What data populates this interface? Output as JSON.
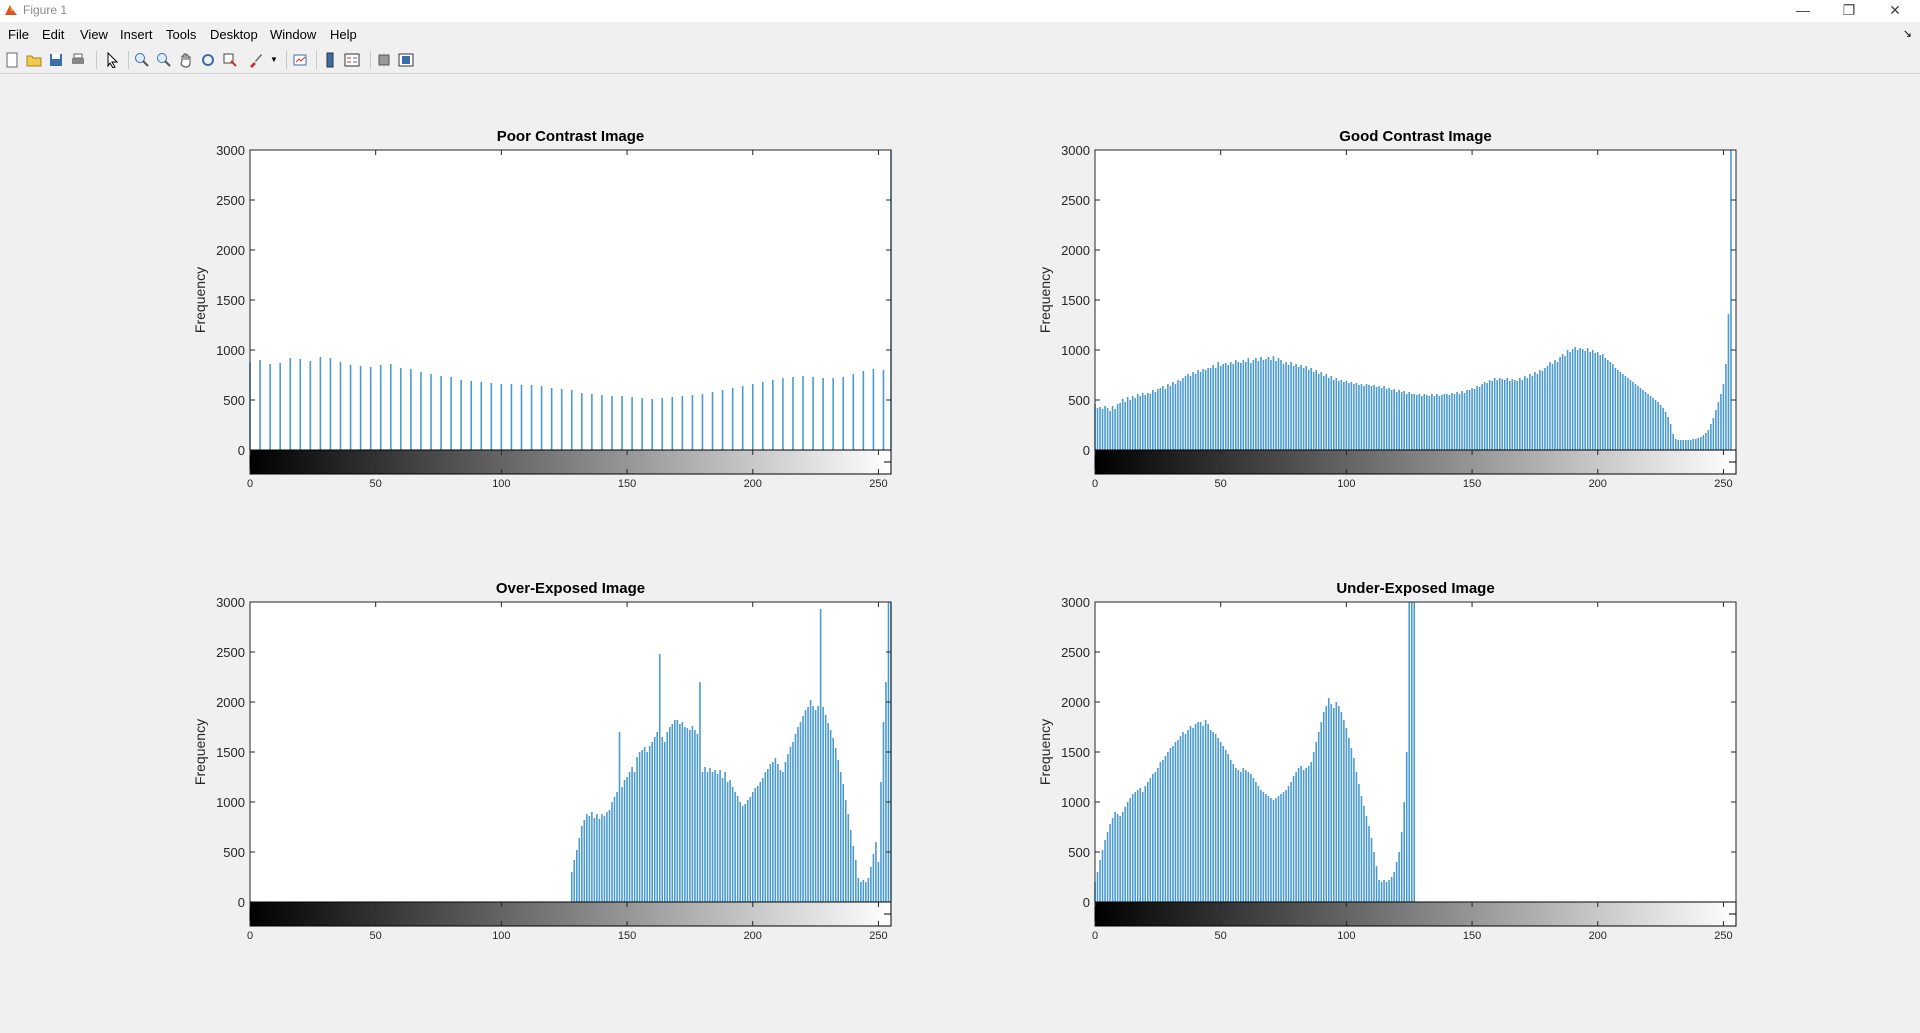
{
  "window": {
    "title": "Figure 1",
    "minimize": "—",
    "restore": "❐",
    "close": "✕"
  },
  "menu": [
    "File",
    "Edit",
    "View",
    "Insert",
    "Tools",
    "Desktop",
    "Window",
    "Help"
  ],
  "toolbar": {
    "icons": [
      "new-figure-icon",
      "open-file-icon",
      "save-icon",
      "print-icon",
      "pointer-icon",
      "zoom-in-icon",
      "zoom-out-icon",
      "pan-icon",
      "rotate-3d-icon",
      "data-cursor-icon",
      "brush-icon",
      "brush-dropdown-icon",
      "link-plot-icon",
      "colorbar-icon",
      "legend-icon",
      "hide-plot-tools-icon",
      "show-plot-tools-icon"
    ]
  },
  "colors": {
    "bar": "#4c9bd0",
    "background": "#f0f0f0"
  },
  "chart_data": [
    {
      "type": "bar",
      "title": "Poor Contrast Image",
      "xlabel": "",
      "ylabel": "Frequency",
      "xlim": [
        0,
        255
      ],
      "ylim": [
        0,
        3000
      ],
      "xticks": [
        0,
        50,
        100,
        150,
        200,
        250
      ],
      "yticks": [
        0,
        500,
        1000,
        1500,
        2000,
        2500,
        3000
      ],
      "grayscale_colorbar": true,
      "x": [
        0,
        4,
        8,
        12,
        16,
        20,
        24,
        28,
        32,
        36,
        40,
        44,
        48,
        52,
        56,
        60,
        64,
        68,
        72,
        76,
        80,
        84,
        88,
        92,
        96,
        100,
        104,
        108,
        112,
        116,
        120,
        124,
        128,
        132,
        136,
        140,
        144,
        148,
        152,
        156,
        160,
        164,
        168,
        172,
        176,
        180,
        184,
        188,
        192,
        196,
        200,
        204,
        208,
        212,
        216,
        220,
        224,
        228,
        232,
        236,
        240,
        244,
        248,
        252,
        255
      ],
      "values": [
        880,
        900,
        860,
        870,
        920,
        910,
        890,
        930,
        920,
        880,
        850,
        840,
        830,
        850,
        860,
        820,
        810,
        780,
        760,
        740,
        730,
        700,
        690,
        680,
        670,
        660,
        660,
        650,
        650,
        640,
        620,
        610,
        600,
        570,
        560,
        550,
        540,
        540,
        530,
        520,
        510,
        520,
        530,
        540,
        550,
        560,
        580,
        600,
        620,
        640,
        660,
        680,
        700,
        720,
        730,
        740,
        730,
        720,
        720,
        730,
        760,
        790,
        810,
        800,
        3000
      ]
    },
    {
      "type": "bar",
      "title": "Good Contrast Image",
      "xlabel": "",
      "ylabel": "Frequency",
      "xlim": [
        0,
        255
      ],
      "ylim": [
        0,
        3000
      ],
      "xticks": [
        0,
        50,
        100,
        150,
        200,
        250
      ],
      "yticks": [
        0,
        500,
        1000,
        1500,
        2000,
        2500,
        3000
      ],
      "grayscale_colorbar": true,
      "x": [
        0,
        1,
        2,
        3,
        4,
        5,
        6,
        7,
        8,
        9,
        10,
        11,
        12,
        13,
        14,
        15,
        16,
        17,
        18,
        19,
        20,
        21,
        22,
        23,
        24,
        25,
        26,
        27,
        28,
        29,
        30,
        31,
        32,
        33,
        34,
        35,
        36,
        37,
        38,
        39,
        40,
        41,
        42,
        43,
        44,
        45,
        46,
        47,
        48,
        49,
        50,
        51,
        52,
        53,
        54,
        55,
        56,
        57,
        58,
        59,
        60,
        61,
        62,
        63,
        64,
        65,
        66,
        67,
        68,
        69,
        70,
        71,
        72,
        73,
        74,
        75,
        76,
        77,
        78,
        79,
        80,
        81,
        82,
        83,
        84,
        85,
        86,
        87,
        88,
        89,
        90,
        91,
        92,
        93,
        94,
        95,
        96,
        97,
        98,
        99,
        100,
        101,
        102,
        103,
        104,
        105,
        106,
        107,
        108,
        109,
        110,
        111,
        112,
        113,
        114,
        115,
        116,
        117,
        118,
        119,
        120,
        121,
        122,
        123,
        124,
        125,
        126,
        127,
        128,
        129,
        130,
        131,
        132,
        133,
        134,
        135,
        136,
        137,
        138,
        139,
        140,
        141,
        142,
        143,
        144,
        145,
        146,
        147,
        148,
        149,
        150,
        151,
        152,
        153,
        154,
        155,
        156,
        157,
        158,
        159,
        160,
        161,
        162,
        163,
        164,
        165,
        166,
        167,
        168,
        169,
        170,
        171,
        172,
        173,
        174,
        175,
        176,
        177,
        178,
        179,
        180,
        181,
        182,
        183,
        184,
        185,
        186,
        187,
        188,
        189,
        190,
        191,
        192,
        193,
        194,
        195,
        196,
        197,
        198,
        199,
        200,
        201,
        202,
        203,
        204,
        205,
        206,
        207,
        208,
        209,
        210,
        211,
        212,
        213,
        214,
        215,
        216,
        217,
        218,
        219,
        220,
        221,
        222,
        223,
        224,
        225,
        226,
        227,
        228,
        229,
        230,
        231,
        232,
        233,
        234,
        235,
        236,
        237,
        238,
        239,
        240,
        241,
        242,
        243,
        244,
        245,
        246,
        247,
        248,
        249,
        250,
        251,
        252,
        253,
        254,
        255
      ],
      "values": [
        460,
        420,
        430,
        410,
        440,
        420,
        390,
        440,
        410,
        460,
        470,
        510,
        480,
        530,
        500,
        540,
        520,
        560,
        540,
        570,
        550,
        570,
        560,
        600,
        580,
        610,
        620,
        640,
        610,
        660,
        640,
        680,
        660,
        700,
        690,
        720,
        740,
        760,
        740,
        780,
        760,
        800,
        780,
        810,
        800,
        820,
        820,
        850,
        820,
        880,
        840,
        860,
        870,
        850,
        880,
        860,
        900,
        880,
        870,
        900,
        880,
        920,
        870,
        900,
        920,
        890,
        930,
        900,
        910,
        930,
        900,
        940,
        890,
        920,
        900,
        860,
        880,
        850,
        880,
        840,
        860,
        830,
        850,
        820,
        840,
        800,
        820,
        780,
        800,
        760,
        780,
        740,
        760,
        720,
        740,
        700,
        720,
        690,
        700,
        680,
        690,
        670,
        680,
        660,
        670,
        650,
        660,
        640,
        660,
        650,
        640,
        650,
        630,
        640,
        620,
        640,
        610,
        620,
        600,
        610,
        580,
        600,
        580,
        590,
        560,
        580,
        560,
        560,
        550,
        560,
        540,
        560,
        550,
        540,
        560,
        540,
        560,
        540,
        550,
        560,
        560,
        550,
        570,
        560,
        580,
        560,
        590,
        570,
        600,
        600,
        620,
        610,
        640,
        630,
        660,
        680,
        670,
        700,
        690,
        720,
        700,
        720,
        710,
        700,
        720,
        690,
        710,
        700,
        690,
        720,
        700,
        740,
        720,
        760,
        740,
        780,
        760,
        800,
        790,
        820,
        840,
        880,
        860,
        900,
        880,
        930,
        960,
        940,
        1000,
        980,
        1010,
        1030,
        1000,
        1020,
        1010,
        990,
        1020,
        980,
        1000,
        970,
        980,
        950,
        960,
        920,
        900,
        880,
        860,
        820,
        800,
        780,
        760,
        740,
        720,
        700,
        680,
        660,
        640,
        620,
        600,
        580,
        560,
        540,
        520,
        500,
        480,
        450,
        420,
        380,
        330,
        260,
        160,
        110,
        100,
        100,
        100,
        100,
        100,
        100,
        110,
        110,
        120,
        130,
        150,
        170,
        200,
        260,
        320,
        400,
        480,
        560,
        660,
        860,
        1360,
        3000
      ]
    },
    {
      "type": "bar",
      "title": "Over-Exposed Image",
      "xlabel": "",
      "ylabel": "Frequency",
      "xlim": [
        0,
        255
      ],
      "ylim": [
        0,
        3000
      ],
      "xticks": [
        0,
        50,
        100,
        150,
        200,
        250
      ],
      "yticks": [
        0,
        500,
        1000,
        1500,
        2000,
        2500,
        3000
      ],
      "grayscale_colorbar": true,
      "x": [
        128,
        129,
        130,
        131,
        132,
        133,
        134,
        135,
        136,
        137,
        138,
        139,
        140,
        141,
        142,
        143,
        144,
        145,
        146,
        147,
        148,
        149,
        150,
        151,
        152,
        153,
        154,
        155,
        156,
        157,
        158,
        159,
        160,
        161,
        162,
        163,
        164,
        165,
        166,
        167,
        168,
        169,
        170,
        171,
        172,
        173,
        174,
        175,
        176,
        177,
        178,
        179,
        180,
        181,
        182,
        183,
        184,
        185,
        186,
        187,
        188,
        189,
        190,
        191,
        192,
        193,
        194,
        195,
        196,
        197,
        198,
        199,
        200,
        201,
        202,
        203,
        204,
        205,
        206,
        207,
        208,
        209,
        210,
        211,
        212,
        213,
        214,
        215,
        216,
        217,
        218,
        219,
        220,
        221,
        222,
        223,
        224,
        225,
        226,
        227,
        228,
        229,
        230,
        231,
        232,
        233,
        234,
        235,
        236,
        237,
        238,
        239,
        240,
        241,
        242,
        243,
        244,
        245,
        246,
        247,
        248,
        249,
        250,
        251,
        252,
        253,
        254,
        255
      ],
      "values": [
        300,
        420,
        520,
        640,
        760,
        820,
        880,
        860,
        900,
        840,
        880,
        830,
        880,
        860,
        900,
        920,
        1000,
        1050,
        1100,
        1700,
        1150,
        1220,
        1250,
        1300,
        1350,
        1300,
        1450,
        1500,
        1520,
        1550,
        1500,
        1560,
        1600,
        1650,
        1700,
        2480,
        1650,
        1600,
        1700,
        1750,
        1780,
        1820,
        1820,
        1780,
        1800,
        1750,
        1740,
        1720,
        1760,
        1720,
        1680,
        2200,
        1300,
        1350,
        1300,
        1340,
        1300,
        1320,
        1280,
        1320,
        1240,
        1300,
        1200,
        1220,
        1150,
        1100,
        1060,
        1000,
        960,
        980,
        1020,
        1050,
        1100,
        1140,
        1160,
        1200,
        1240,
        1300,
        1330,
        1380,
        1400,
        1440,
        1380,
        1320,
        1300,
        1400,
        1480,
        1550,
        1600,
        1680,
        1750,
        1800,
        1860,
        1920,
        1950,
        2020,
        1960,
        1920,
        1960,
        2930,
        1950,
        1870,
        1790,
        1720,
        1640,
        1540,
        1420,
        1300,
        1180,
        1020,
        880,
        720,
        560,
        420,
        240,
        200,
        220,
        200,
        240,
        350,
        480,
        600,
        400,
        1200,
        1800,
        2200,
        3000,
        3000
      ]
    },
    {
      "type": "bar",
      "title": "Under-Exposed Image",
      "xlabel": "",
      "ylabel": "Frequency",
      "xlim": [
        0,
        255
      ],
      "ylim": [
        0,
        3000
      ],
      "xticks": [
        0,
        50,
        100,
        150,
        200,
        250
      ],
      "yticks": [
        0,
        500,
        1000,
        1500,
        2000,
        2500,
        3000
      ],
      "grayscale_colorbar": true,
      "x": [
        0,
        1,
        2,
        3,
        4,
        5,
        6,
        7,
        8,
        9,
        10,
        11,
        12,
        13,
        14,
        15,
        16,
        17,
        18,
        19,
        20,
        21,
        22,
        23,
        24,
        25,
        26,
        27,
        28,
        29,
        30,
        31,
        32,
        33,
        34,
        35,
        36,
        37,
        38,
        39,
        40,
        41,
        42,
        43,
        44,
        45,
        46,
        47,
        48,
        49,
        50,
        51,
        52,
        53,
        54,
        55,
        56,
        57,
        58,
        59,
        60,
        61,
        62,
        63,
        64,
        65,
        66,
        67,
        68,
        69,
        70,
        71,
        72,
        73,
        74,
        75,
        76,
        77,
        78,
        79,
        80,
        81,
        82,
        83,
        84,
        85,
        86,
        87,
        88,
        89,
        90,
        91,
        92,
        93,
        94,
        95,
        96,
        97,
        98,
        99,
        100,
        101,
        102,
        103,
        104,
        105,
        106,
        107,
        108,
        109,
        110,
        111,
        112,
        113,
        114,
        115,
        116,
        117,
        118,
        119,
        120,
        121,
        122,
        123,
        124,
        125,
        126,
        127
      ],
      "values": [
        200,
        300,
        420,
        520,
        620,
        700,
        780,
        840,
        900,
        880,
        860,
        900,
        950,
        1000,
        1040,
        1080,
        1100,
        1120,
        1140,
        1100,
        1160,
        1200,
        1240,
        1280,
        1300,
        1340,
        1400,
        1420,
        1460,
        1500,
        1540,
        1560,
        1600,
        1620,
        1660,
        1700,
        1680,
        1720,
        1760,
        1740,
        1780,
        1800,
        1800,
        1760,
        1820,
        1780,
        1720,
        1700,
        1680,
        1640,
        1600,
        1560,
        1520,
        1480,
        1420,
        1380,
        1340,
        1320,
        1300,
        1340,
        1320,
        1300,
        1280,
        1240,
        1200,
        1160,
        1120,
        1100,
        1080,
        1060,
        1040,
        1020,
        1040,
        1060,
        1080,
        1100,
        1120,
        1160,
        1200,
        1260,
        1300,
        1340,
        1360,
        1320,
        1340,
        1360,
        1400,
        1500,
        1600,
        1700,
        1800,
        1900,
        1960,
        2040,
        1980,
        1940,
        2000,
        1960,
        1900,
        1820,
        1740,
        1640,
        1540,
        1440,
        1300,
        1180,
        1060,
        960,
        860,
        760,
        640,
        500,
        360,
        220,
        200,
        220,
        200,
        220,
        250,
        300,
        400,
        500,
        700,
        1000,
        1500,
        3000,
        3000,
        3000
      ]
    }
  ]
}
